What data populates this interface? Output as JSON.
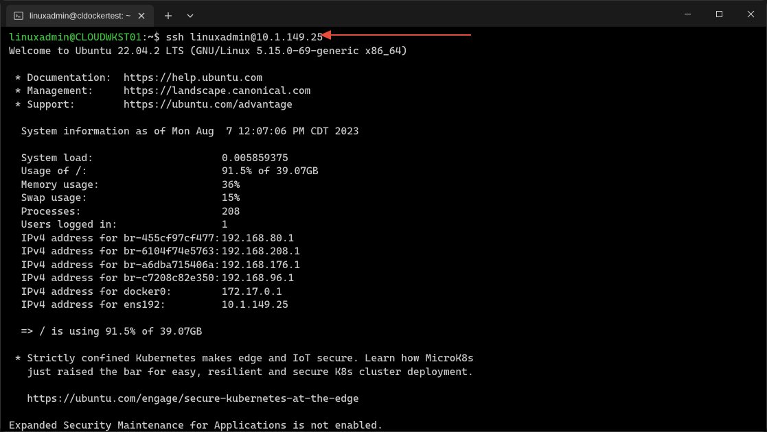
{
  "titlebar": {
    "tab_title": "linuxadmin@cldockertest: ~"
  },
  "prompt": {
    "user_host": "linuxadmin@CLOUDWKST01",
    "path": ":~$",
    "command": "ssh linuxadmin@10.1.149.25"
  },
  "welcome": "Welcome to Ubuntu 22.04.2 LTS (GNU/Linux 5.15.0-69-generic x86_64)",
  "links": {
    "doc_label": " * Documentation:  ",
    "doc_url": "https://help.ubuntu.com",
    "mgmt_label": " * Management:     ",
    "mgmt_url": "https://landscape.canonical.com",
    "sup_label": " * Support:        ",
    "sup_url": "https://ubuntu.com/advantage"
  },
  "sysinfo_header": "  System information as of Mon Aug  7 12:07:06 PM CDT 2023",
  "sysinfo": [
    {
      "label": "  System load:",
      "value": "0.005859375"
    },
    {
      "label": "  Usage of /:",
      "value": "91.5% of 39.07GB"
    },
    {
      "label": "  Memory usage:",
      "value": "36%"
    },
    {
      "label": "  Swap usage:",
      "value": "15%"
    },
    {
      "label": "  Processes:",
      "value": "208"
    },
    {
      "label": "  Users logged in:",
      "value": "1"
    },
    {
      "label": "  IPv4 address for br-455cf97cf477:",
      "value": "192.168.80.1"
    },
    {
      "label": "  IPv4 address for br-6104f74e5763:",
      "value": "192.168.208.1"
    },
    {
      "label": "  IPv4 address for br-a6dba715406a:",
      "value": "192.168.176.1"
    },
    {
      "label": "  IPv4 address for br-c7208c82e350:",
      "value": "192.168.96.1"
    },
    {
      "label": "  IPv4 address for docker0:",
      "value": "172.17.0.1"
    },
    {
      "label": "  IPv4 address for ens192:",
      "value": "10.1.149.25"
    }
  ],
  "warning": "  => / is using 91.5% of 39.07GB",
  "motd": {
    "line1": " * Strictly confined Kubernetes makes edge and IoT secure. Learn how MicroK8s",
    "line2": "   just raised the bar for easy, resilient and secure K8s cluster deployment.",
    "url": "   https://ubuntu.com/engage/secure-kubernetes-at-the-edge"
  },
  "esm": "Expanded Security Maintenance for Applications is not enabled."
}
